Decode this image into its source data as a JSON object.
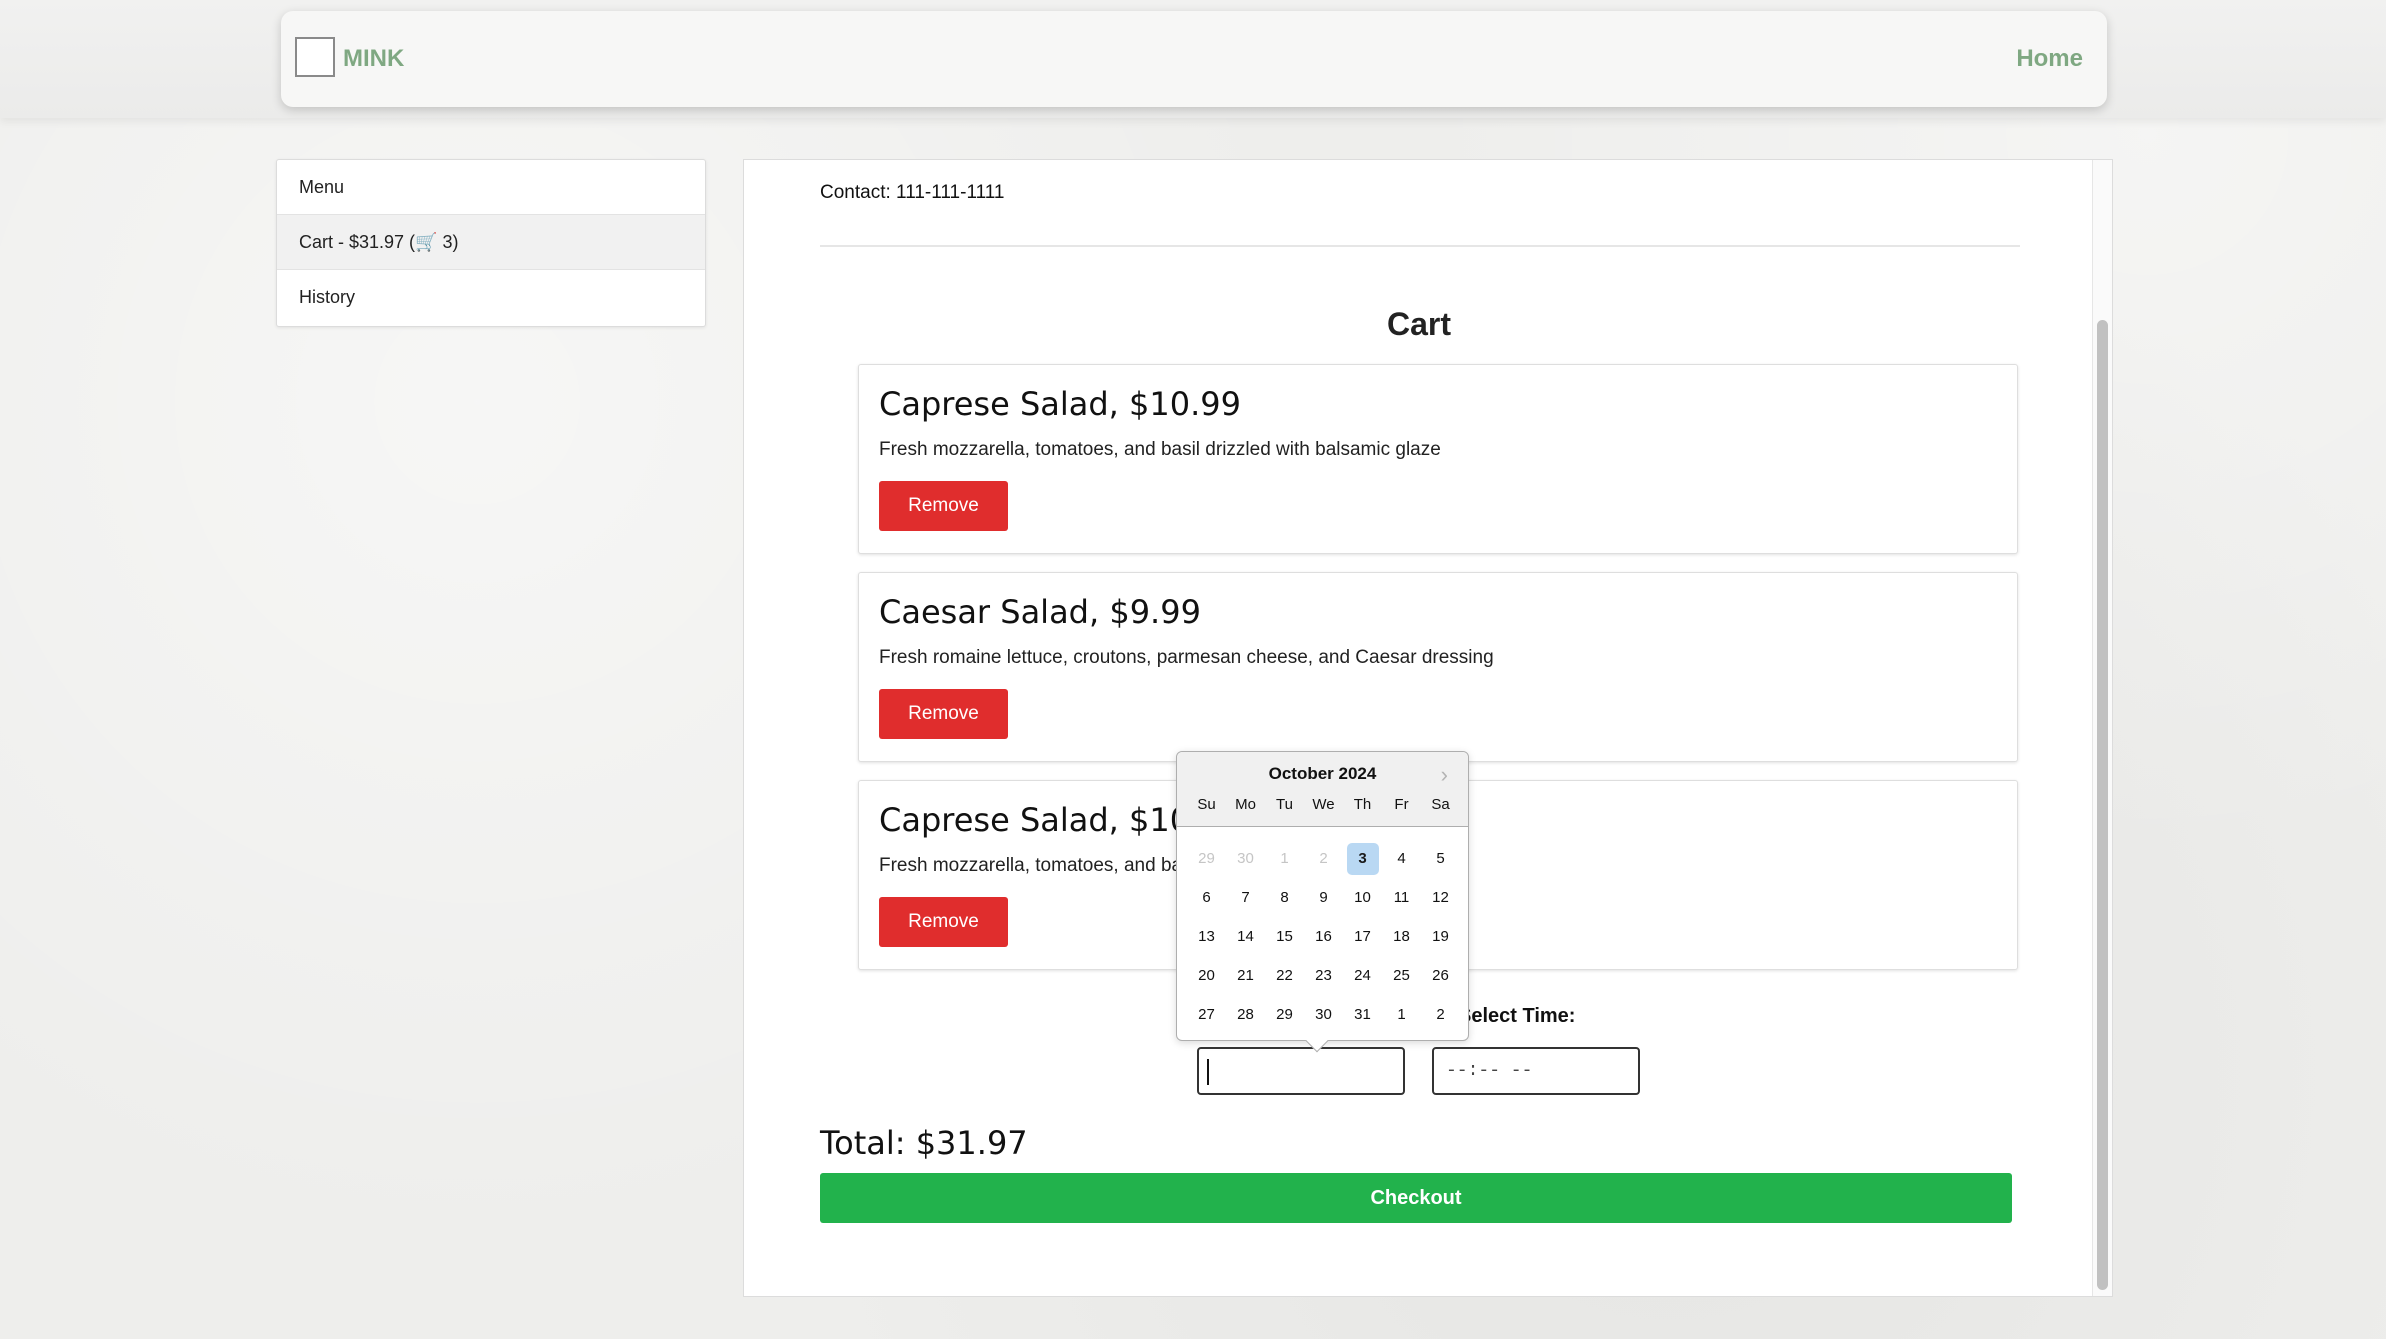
{
  "header": {
    "brand": "MINK",
    "home_label": "Home"
  },
  "sidebar": {
    "items": [
      {
        "label": "Menu"
      },
      {
        "label": "Cart - $31.97 (🛒 3)"
      },
      {
        "label": "History"
      }
    ]
  },
  "main": {
    "contact": "Contact: 111-111-1111",
    "title": "Cart",
    "items": [
      {
        "title": "Caprese Salad, $10.99",
        "description": "Fresh mozzarella, tomatoes, and basil drizzled with balsamic glaze",
        "remove_label": "Remove"
      },
      {
        "title": "Caesar Salad, $9.99",
        "description": "Fresh romaine lettuce, croutons, parmesan cheese, and Caesar dressing",
        "remove_label": "Remove"
      },
      {
        "title": "Caprese Salad, $10.99",
        "description": "Fresh mozzarella, tomatoes, and basil drizzled with balsamic glaze",
        "remove_label": "Remove"
      }
    ],
    "select_time_label": "Select Time:",
    "date_value": "",
    "time_placeholder": "--:-- --",
    "total": "Total: $31.97",
    "checkout_label": "Checkout"
  },
  "datepicker": {
    "month_label": "October 2024",
    "weekdays": [
      "Su",
      "Mo",
      "Tu",
      "We",
      "Th",
      "Fr",
      "Sa"
    ],
    "days": [
      {
        "d": "29",
        "muted": true
      },
      {
        "d": "30",
        "muted": true
      },
      {
        "d": "1",
        "muted": true
      },
      {
        "d": "2",
        "muted": true
      },
      {
        "d": "3",
        "selected": true
      },
      {
        "d": "4"
      },
      {
        "d": "5"
      },
      {
        "d": "6"
      },
      {
        "d": "7"
      },
      {
        "d": "8"
      },
      {
        "d": "9"
      },
      {
        "d": "10"
      },
      {
        "d": "11"
      },
      {
        "d": "12"
      },
      {
        "d": "13"
      },
      {
        "d": "14"
      },
      {
        "d": "15"
      },
      {
        "d": "16"
      },
      {
        "d": "17"
      },
      {
        "d": "18"
      },
      {
        "d": "19"
      },
      {
        "d": "20"
      },
      {
        "d": "21"
      },
      {
        "d": "22"
      },
      {
        "d": "23"
      },
      {
        "d": "24"
      },
      {
        "d": "25"
      },
      {
        "d": "26"
      },
      {
        "d": "27"
      },
      {
        "d": "28"
      },
      {
        "d": "29"
      },
      {
        "d": "30"
      },
      {
        "d": "31"
      },
      {
        "d": "1"
      },
      {
        "d": "2"
      }
    ]
  },
  "colors": {
    "brand_green": "#7fa882",
    "remove_red": "#e02d2d",
    "checkout_green": "#22b24c",
    "selected_day": "#b9d8f3"
  }
}
